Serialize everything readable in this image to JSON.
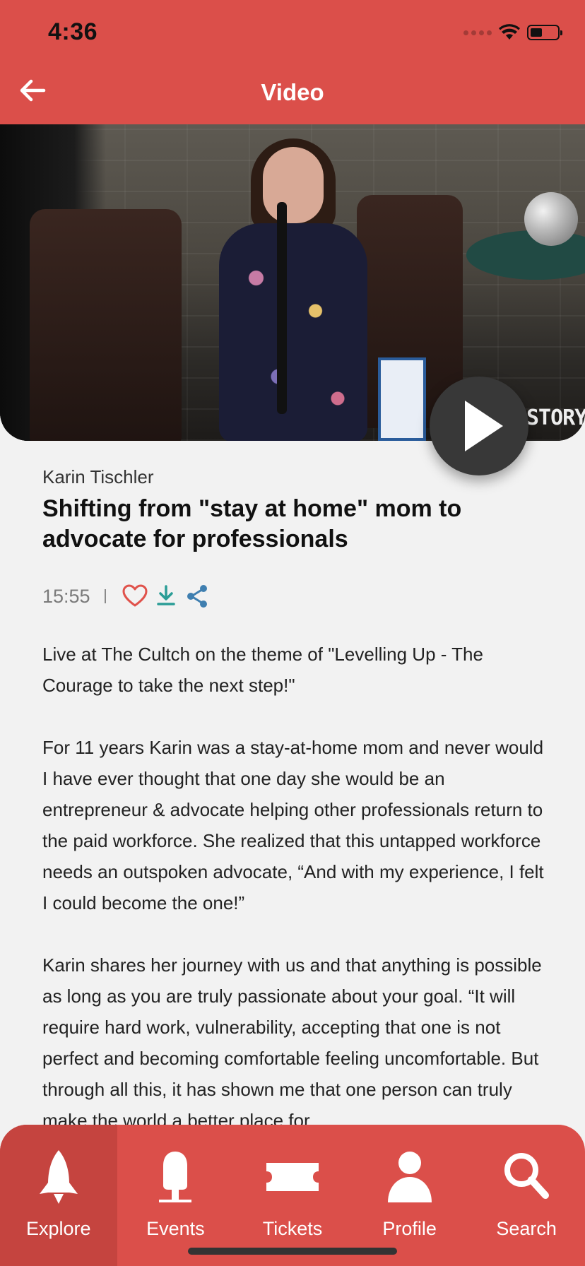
{
  "status_bar": {
    "time": "4:36"
  },
  "header": {
    "title": "Video",
    "back_icon": "arrow-left-icon"
  },
  "video": {
    "watermark": "STORY",
    "play_icon": "play-icon"
  },
  "talk": {
    "speaker": "Karin Tischler",
    "title": "Shifting from \"stay at home\" mom to advocate for professionals",
    "duration": "15:55",
    "actions": [
      "heart-icon",
      "download-icon",
      "share-icon"
    ]
  },
  "description": {
    "paragraphs": [
      "Live at The Cultch on the theme of \"Levelling Up - The Courage to take the next step!\"",
      "For 11 years Karin was a stay-at-home mom and never would I have ever thought that one day she would be an entrepreneur & advocate helping other professionals return to the paid workforce. She realized that this untapped workforce needs an outspoken advocate, “And with my experience, I felt I could become the one!”",
      "Karin shares her journey with us and that anything is possible as long as you are truly passionate about your goal. “It will require hard work, vulnerability, accepting that one is not perfect and becoming comfortable feeling uncomfortable. But through all this, it has shown me that one person can truly make the world a better place for"
    ]
  },
  "tabbar": {
    "tabs": [
      {
        "label": "Explore",
        "icon": "rocket-icon",
        "active": true
      },
      {
        "label": "Events",
        "icon": "microphone-icon",
        "active": false
      },
      {
        "label": "Tickets",
        "icon": "ticket-icon",
        "active": false
      },
      {
        "label": "Profile",
        "icon": "person-icon",
        "active": false
      },
      {
        "label": "Search",
        "icon": "search-icon",
        "active": false
      }
    ]
  },
  "colors": {
    "brand_red": "#db4f4a",
    "active_tab": "#c5443f",
    "heart": "#e0524b",
    "download": "#2a9d96",
    "share": "#3f7fb0"
  }
}
